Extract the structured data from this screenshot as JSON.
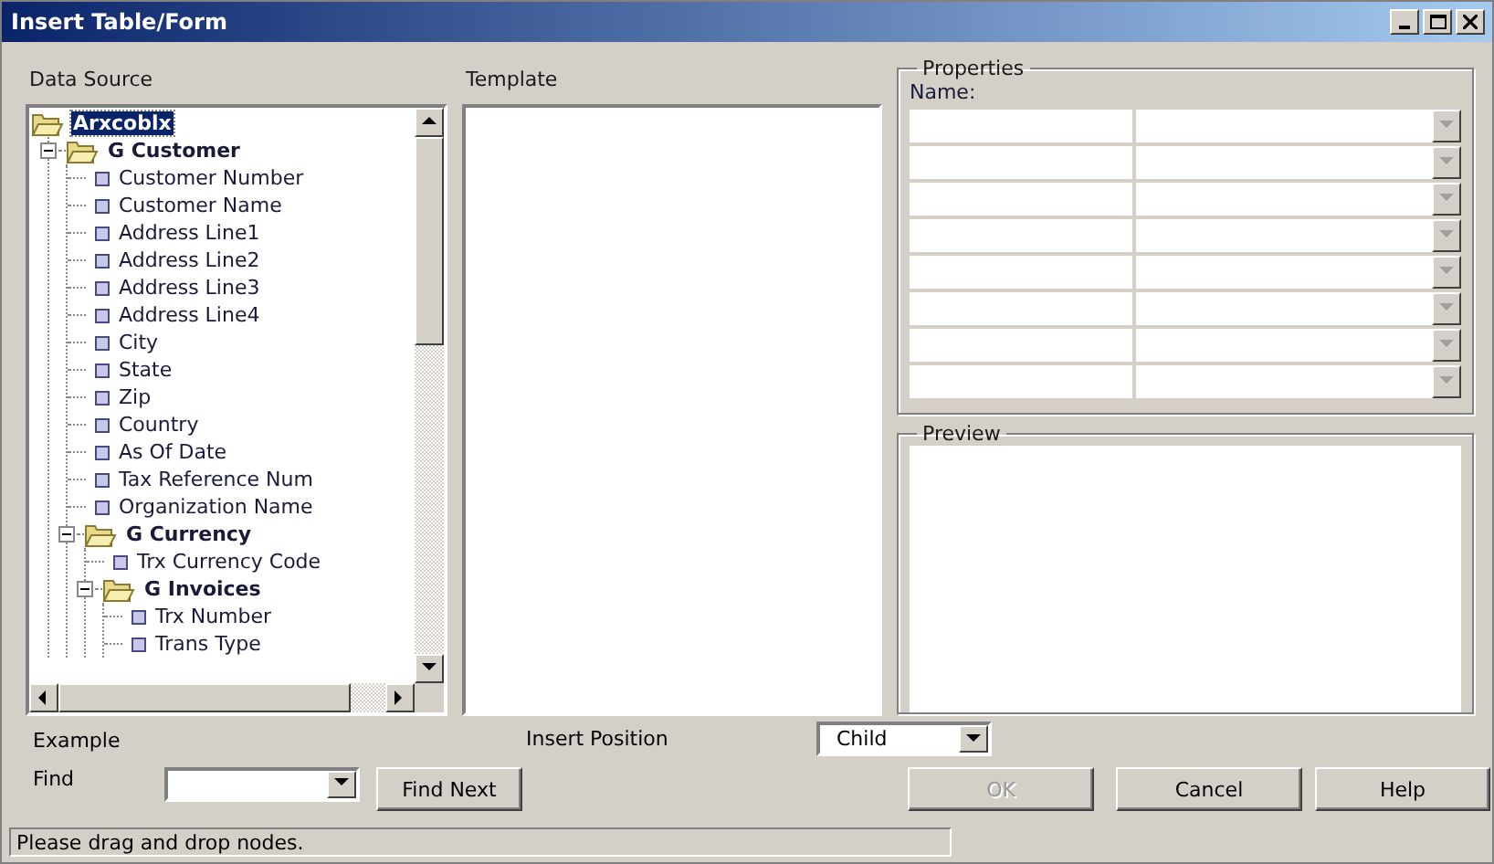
{
  "window": {
    "title": "Insert Table/Form"
  },
  "data_source": {
    "label": "Data Source",
    "tree": [
      {
        "label": "Arxcoblx",
        "kind": "folder",
        "selected": true,
        "children": [
          {
            "label": "G Customer",
            "kind": "folder",
            "expanded": true,
            "selected": false,
            "children": [
              {
                "label": "Customer Number",
                "kind": "field",
                "selected": false
              },
              {
                "label": "Customer Name",
                "kind": "field",
                "selected": false
              },
              {
                "label": "Address Line1",
                "kind": "field",
                "selected": false
              },
              {
                "label": "Address Line2",
                "kind": "field",
                "selected": false
              },
              {
                "label": "Address Line3",
                "kind": "field",
                "selected": false
              },
              {
                "label": "Address Line4",
                "kind": "field",
                "selected": false
              },
              {
                "label": "City",
                "kind": "field",
                "selected": false
              },
              {
                "label": "State",
                "kind": "field",
                "selected": false
              },
              {
                "label": "Zip",
                "kind": "field",
                "selected": false
              },
              {
                "label": "Country",
                "kind": "field",
                "selected": false
              },
              {
                "label": "As Of Date",
                "kind": "field",
                "selected": false
              },
              {
                "label": "Tax Reference Num",
                "kind": "field",
                "selected": false
              },
              {
                "label": "Organization Name",
                "kind": "field",
                "selected": false
              },
              {
                "label": "G Currency",
                "kind": "folder",
                "expanded": true,
                "selected": false,
                "children": [
                  {
                    "label": "Trx Currency Code",
                    "kind": "field",
                    "selected": false
                  },
                  {
                    "label": "G Invoices",
                    "kind": "folder",
                    "expanded": true,
                    "selected": false,
                    "children": [
                      {
                        "label": "Trx Number",
                        "kind": "field",
                        "selected": false
                      },
                      {
                        "label": "Trans Type",
                        "kind": "field",
                        "selected": false
                      }
                    ]
                  }
                ]
              }
            ]
          }
        ]
      }
    ]
  },
  "template": {
    "label": "Template"
  },
  "properties": {
    "title": "Properties",
    "name_label": "Name:"
  },
  "preview": {
    "title": "Preview"
  },
  "example": {
    "label": "Example"
  },
  "find": {
    "label": "Find",
    "button": "Find Next"
  },
  "insert_position": {
    "label": "Insert Position",
    "value": "Child"
  },
  "buttons": [
    {
      "label": "OK",
      "disabled": true
    },
    {
      "label": "Cancel",
      "disabled": false
    },
    {
      "label": "Help",
      "disabled": false
    }
  ],
  "status_bar": "Please drag and drop nodes."
}
